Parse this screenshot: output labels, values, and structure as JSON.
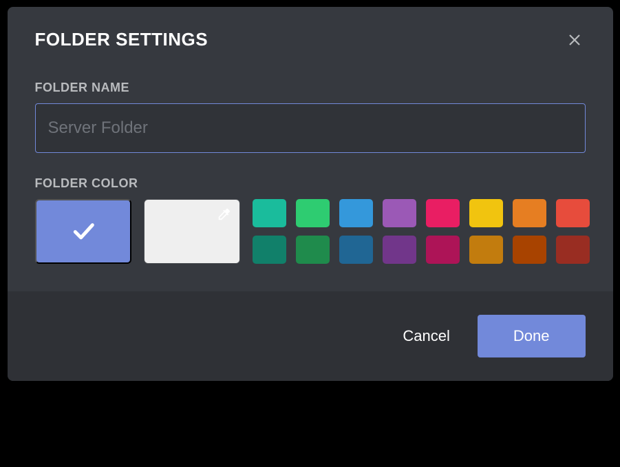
{
  "modal": {
    "title": "Folder Settings"
  },
  "fields": {
    "name_label": "Folder Name",
    "name_value": "",
    "name_placeholder": "Server Folder",
    "color_label": "Folder Color"
  },
  "colors": {
    "selected": "#7289da",
    "row1": [
      "#1abc9c",
      "#2ecc71",
      "#3498db",
      "#9b59b6",
      "#e91e63",
      "#f1c40f",
      "#e67e22",
      "#e74c3c"
    ],
    "row2": [
      "#11806a",
      "#1f8b4c",
      "#206694",
      "#71368a",
      "#ad1457",
      "#c27c0e",
      "#a84300",
      "#992d22"
    ]
  },
  "footer": {
    "cancel": "Cancel",
    "done": "Done"
  }
}
